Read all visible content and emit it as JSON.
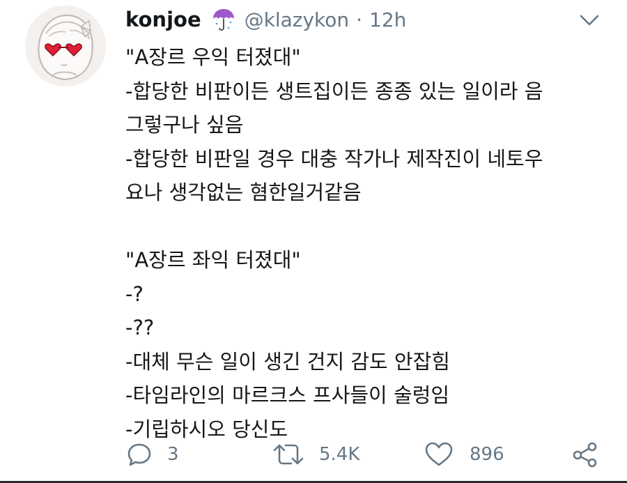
{
  "tweet": {
    "display_name": "konjoe",
    "name_emoji_icon": "umbrella-icon",
    "handle": "@klazykon",
    "separator": "·",
    "time": "12h",
    "lines": [
      "\"A장르 우익 터졌대\"",
      "-합당한 비판이든 생트집이든 종종 있는 일이라 음",
      "그렇구나 싶음",
      "-합당한 비판일 경우 대충 작가나 제작진이 네토우",
      "요나 생각없는 혐한일거같음",
      "",
      "\"A장르 좌익 터졌대\"",
      "-?",
      "-??",
      "-대체 무슨 일이 생긴 건지 감도 안잡힘",
      "-타임라인의 마르크스 프사들이 술렁임",
      "-기립하시오 당신도"
    ]
  },
  "actions": {
    "reply_count": "3",
    "retweet_count": "5.4K",
    "like_count": "896"
  },
  "colors": {
    "text": "#14171a",
    "secondary": "#657786",
    "umbrella": "#9b59c9"
  }
}
